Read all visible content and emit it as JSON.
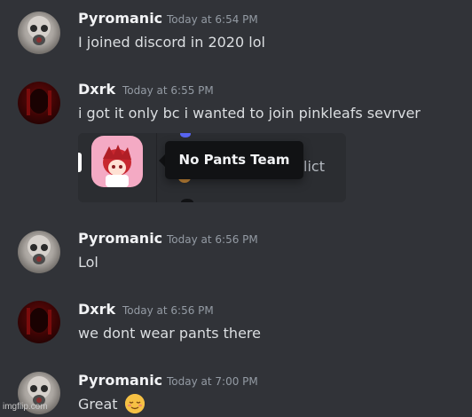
{
  "messages": [
    {
      "author": "Pyromanic",
      "timestamp": "Today at 6:54 PM",
      "text": "I joined discord in 2020 lol",
      "avatar": "gas-mask-avatar"
    },
    {
      "author": "Dxrk",
      "timestamp": "Today at 6:55 PM",
      "text": "i got it only bc i wanted to join pinkleafs sevrver",
      "avatar": "dark-red-avatar"
    },
    {
      "author": "Pyromanic",
      "timestamp": "Today at 6:56 PM",
      "text": "Lol",
      "avatar": "gas-mask-avatar"
    },
    {
      "author": "Dxrk",
      "timestamp": "Today at 6:56 PM",
      "text": "we dont wear pants there",
      "avatar": "dark-red-avatar"
    },
    {
      "author": "Pyromanic",
      "timestamp": "Today at 7:00 PM",
      "text": "Great",
      "avatar": "gas-mask-avatar",
      "emoji": "relieved-face"
    }
  ],
  "embed": {
    "tooltip": "No Pants Team",
    "partial_text": "lict"
  },
  "watermark": "imgflip.com",
  "colors": {
    "background": "#313338",
    "embed": "#2b2d31",
    "tooltip": "#111214",
    "timestamp": "#949ba4",
    "author": "#f2f3f5"
  }
}
